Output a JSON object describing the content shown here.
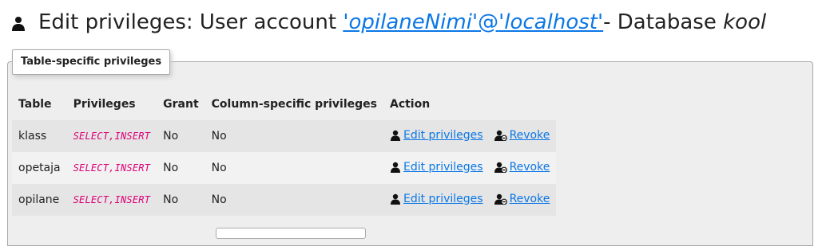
{
  "header": {
    "title_prefix": "Edit privileges: User account ",
    "user_quoted": "'opilaneNimi'",
    "at": "@",
    "host_quoted": "'localhost'",
    "trailing_space": " ",
    "db_prefix": " - Database ",
    "db_name": "kool"
  },
  "section": {
    "legend": "Table-specific privileges"
  },
  "table": {
    "headers": [
      "Table",
      "Privileges",
      "Grant",
      "Column-specific privileges",
      "Action"
    ],
    "rows": [
      {
        "table": "klass",
        "privileges": "SELECT,INSERT",
        "grant": "No",
        "column_specific": "No",
        "edit_label": "Edit privileges",
        "revoke_label": "Revoke"
      },
      {
        "table": "opetaja",
        "privileges": "SELECT,INSERT",
        "grant": "No",
        "column_specific": "No",
        "edit_label": "Edit privileges",
        "revoke_label": "Revoke"
      },
      {
        "table": "opilane",
        "privileges": "SELECT,INSERT",
        "grant": "No",
        "column_specific": "No",
        "edit_label": "Edit privileges",
        "revoke_label": "Revoke"
      }
    ]
  },
  "icons": {
    "title": "user-icon",
    "edit": "user-edit-icon",
    "revoke": "user-revoke-icon"
  },
  "colors": {
    "link": "#0b77e6",
    "privilege_code": "#dd0077",
    "panel_bg": "#eeeeee"
  }
}
